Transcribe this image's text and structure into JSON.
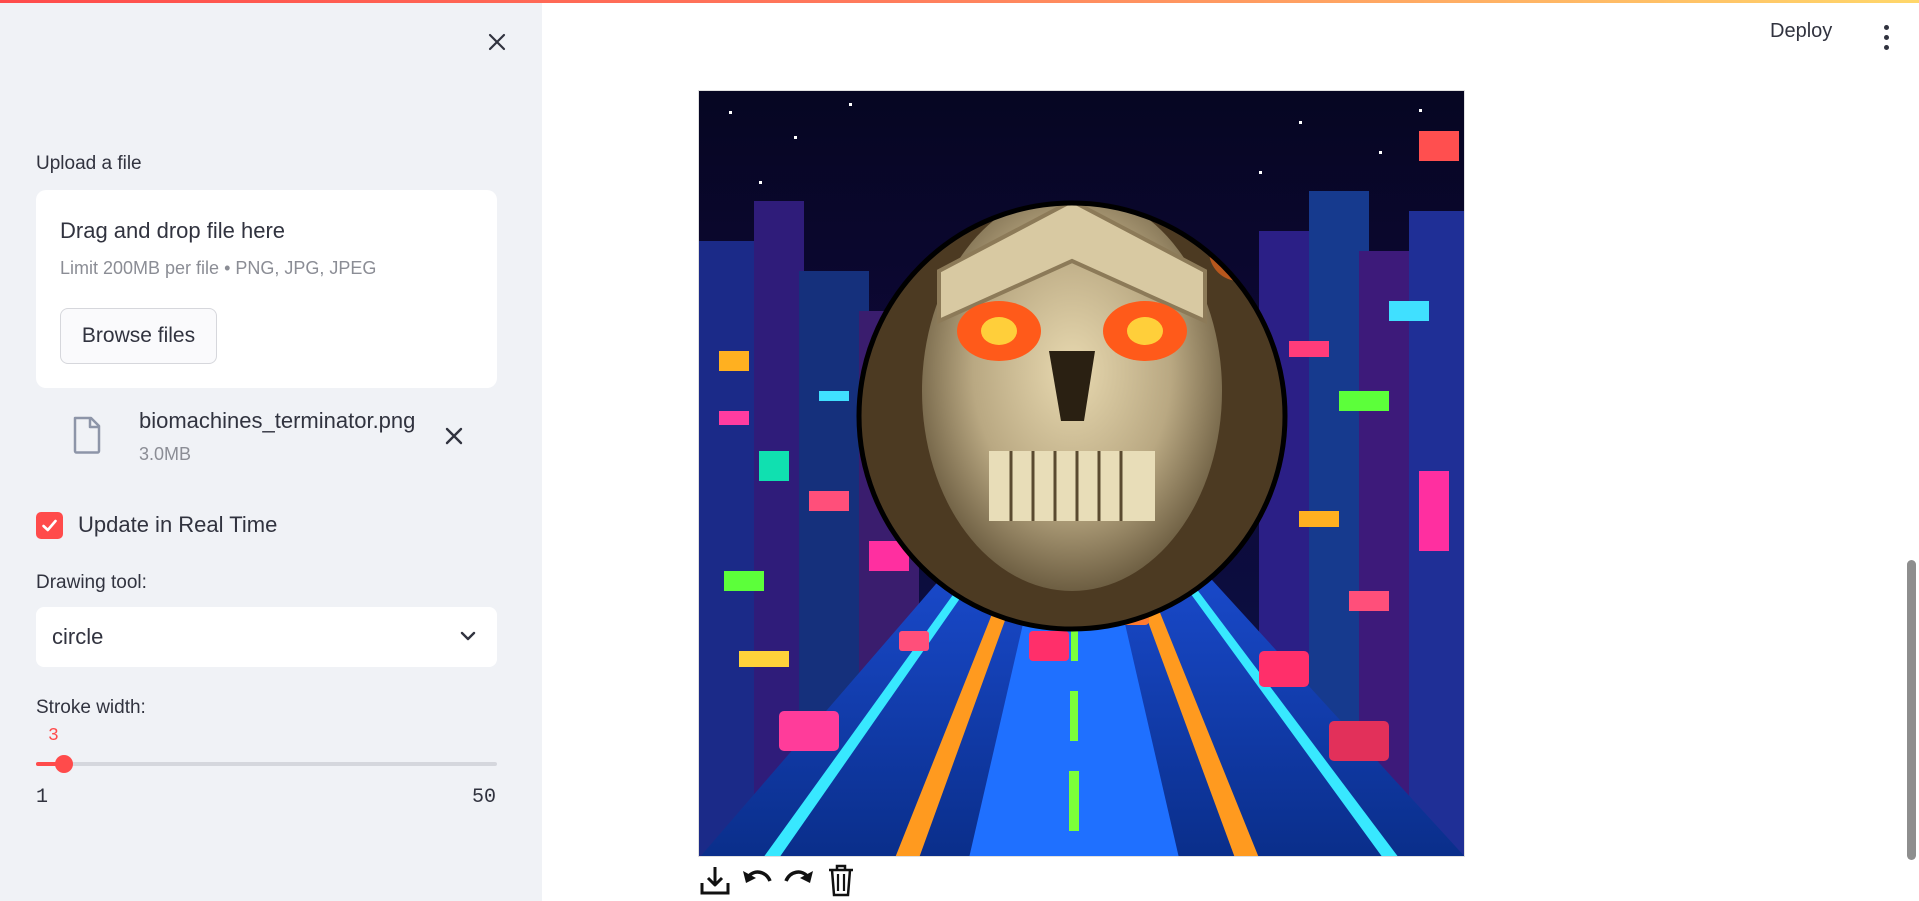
{
  "sidebar": {
    "upload": {
      "label": "Upload a file",
      "dropzone_title": "Drag and drop file here",
      "dropzone_limit": "Limit 200MB per file • PNG, JPG, JPEG",
      "browse_label": "Browse files"
    },
    "file": {
      "name": "biomachines_terminator.png",
      "size": "3.0MB",
      "icon": "file-icon"
    },
    "realtime": {
      "label": "Update in Real Time",
      "checked": true
    },
    "drawing_tool": {
      "label": "Drawing tool:",
      "value": "circle"
    },
    "stroke": {
      "label": "Stroke width:",
      "value": "3",
      "min": "1",
      "max": "50"
    }
  },
  "header": {
    "deploy_label": "Deploy"
  },
  "toolbar": {
    "icons": [
      "download-icon",
      "undo-icon",
      "redo-icon",
      "trash-icon"
    ]
  },
  "colors": {
    "accent": "#ff4b4b",
    "sidebar_bg": "#f0f2f6",
    "text": "#31333f",
    "muted": "#8b8d95"
  }
}
